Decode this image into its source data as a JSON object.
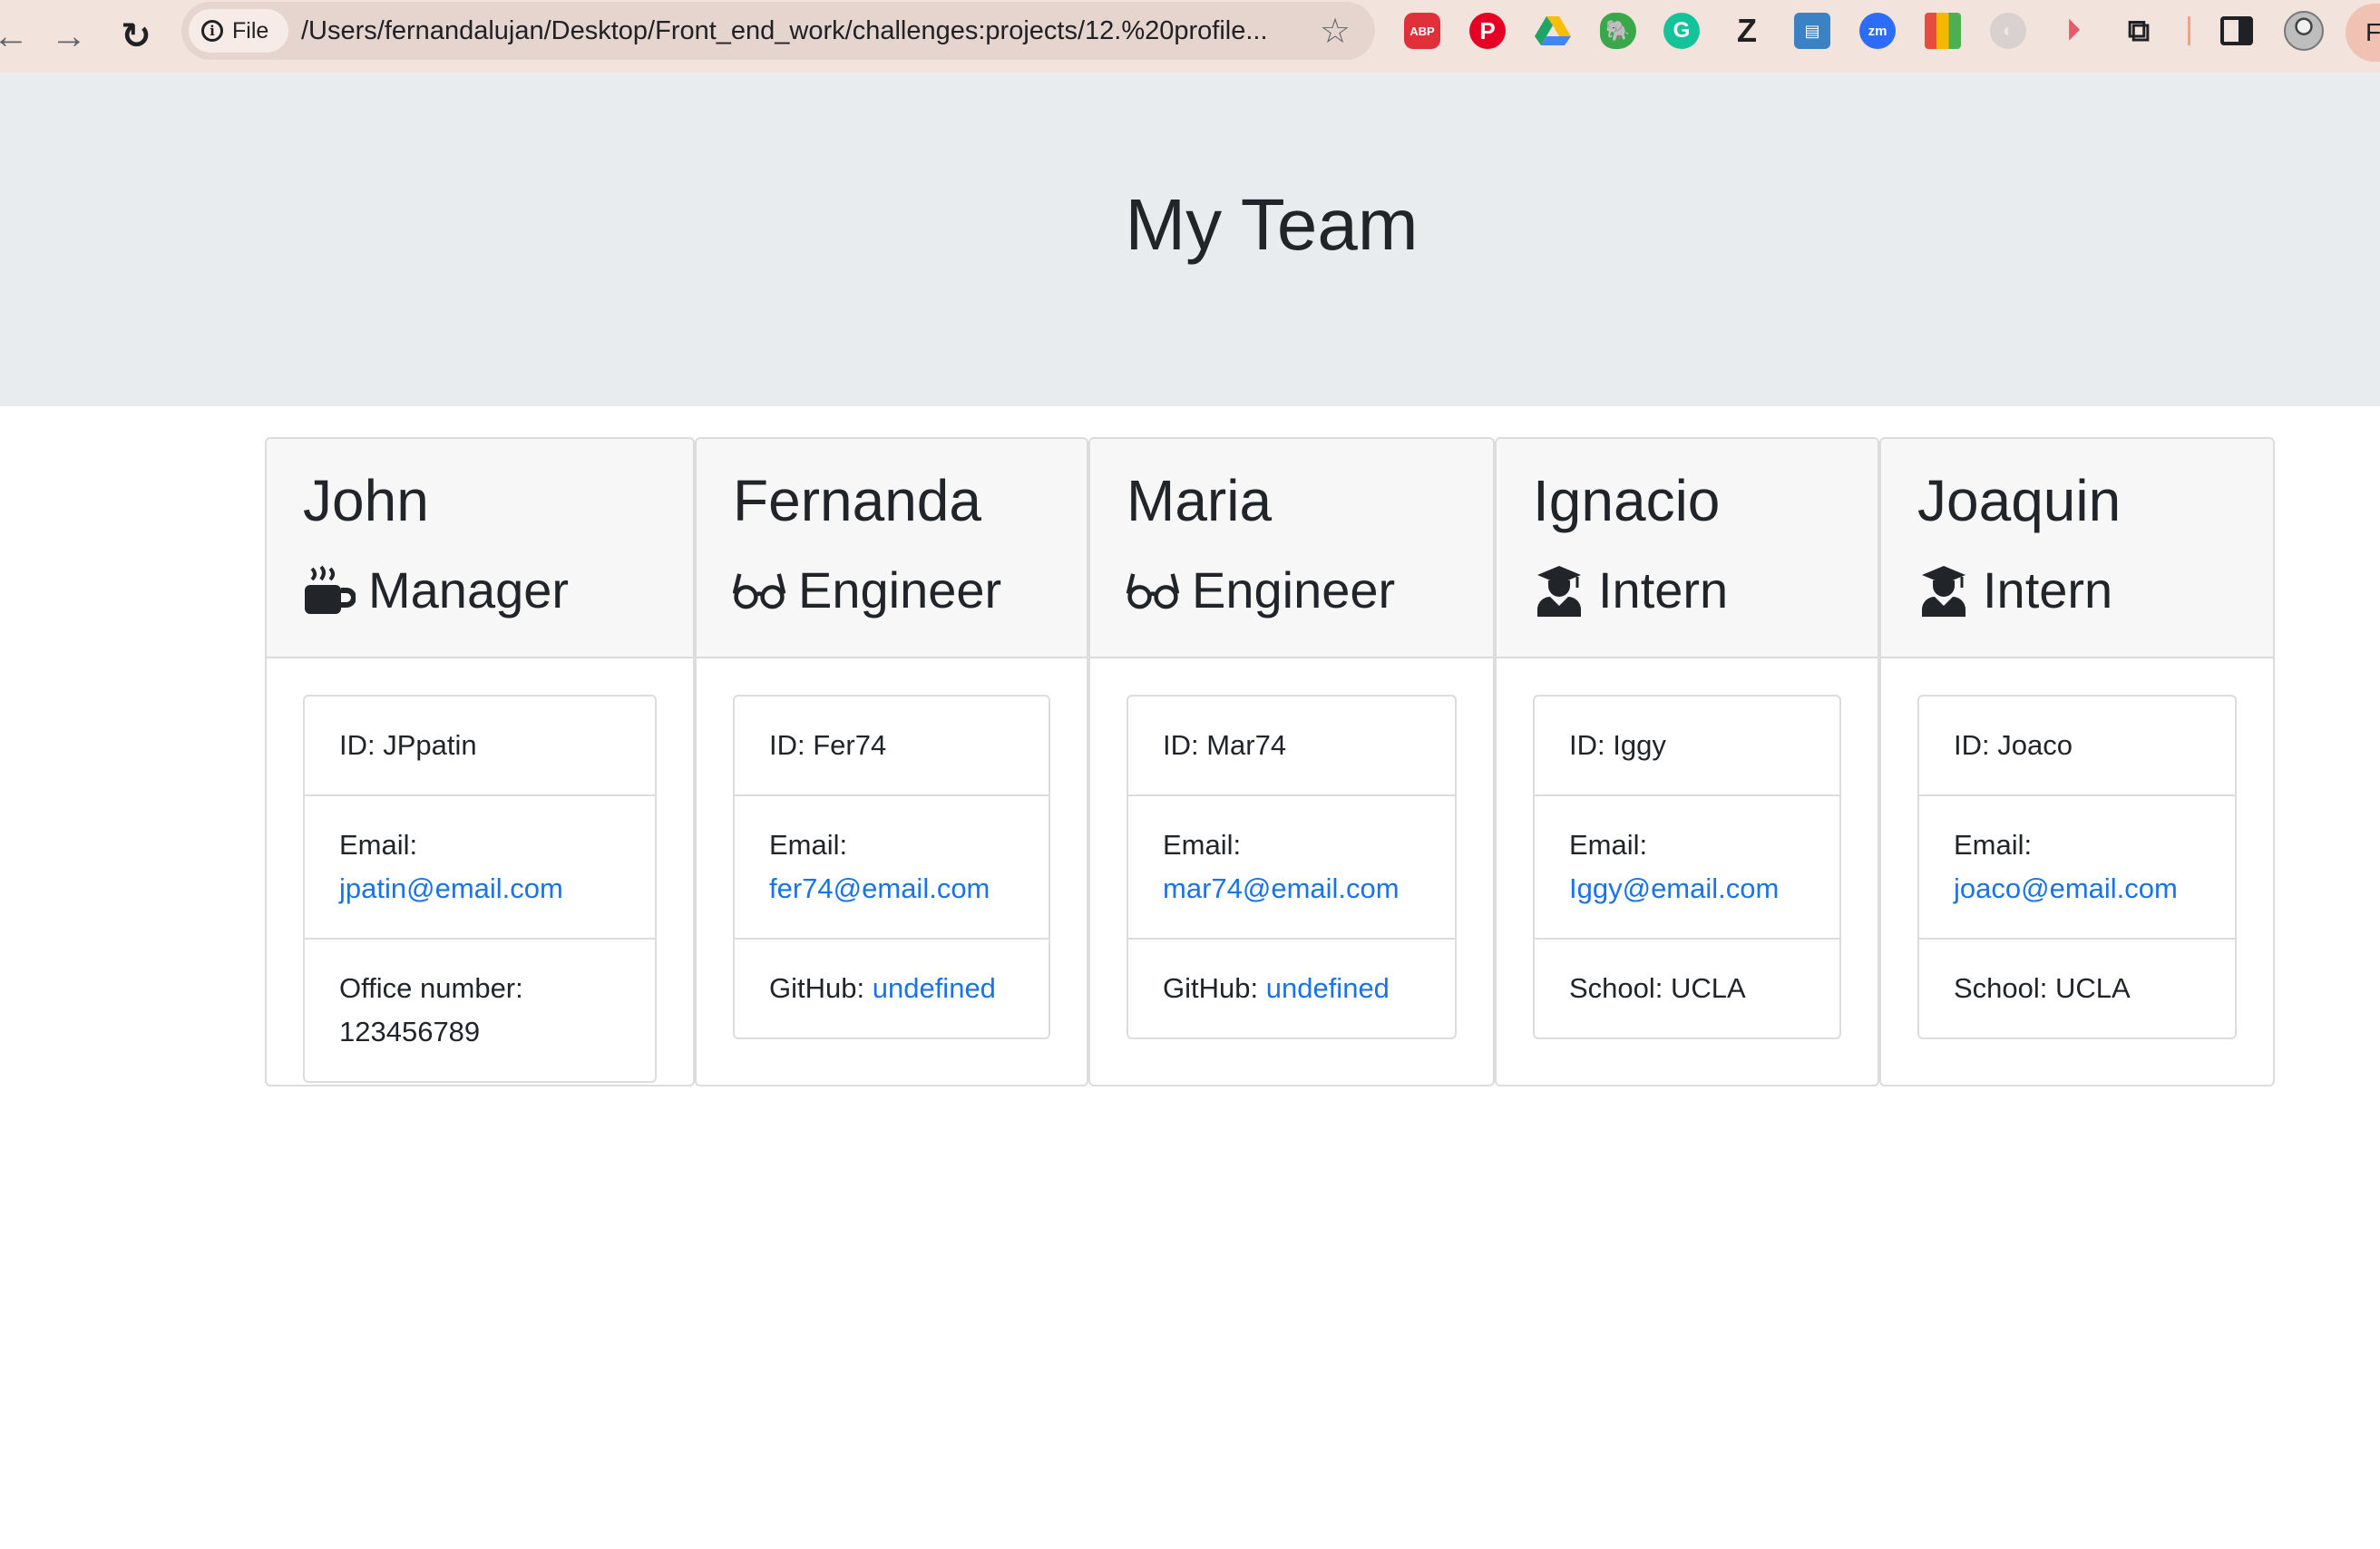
{
  "browser": {
    "nav": {
      "back": "←",
      "forward": "→",
      "reload": "↻"
    },
    "site_chip_label": "File",
    "url": "/Users/fernandalujan/Desktop/Front_end_work/challenges:projects/12.%20profile...",
    "extensions": [
      "abp-icon",
      "pinterest-icon",
      "google-drive-icon",
      "evernote-icon",
      "grammarly-icon",
      "zotero-icon",
      "reader-icon",
      "zoom-icon",
      "color-grid-icon",
      "ghost-icon",
      "screen-recorder-icon",
      "puzzle-extensions-icon"
    ],
    "abp_text": "ABP",
    "zoom_text": "zm",
    "z_text": "Z",
    "profile_initial": "F"
  },
  "page": {
    "title": "My Team"
  },
  "team": [
    {
      "name": "John",
      "role": "Manager",
      "role_icon": "coffee-mug-icon",
      "id_label": "ID: JPpatin",
      "email_label": "Email:",
      "email": "jpatin@email.com",
      "extra_label": "Office number:",
      "extra_value": "123456789"
    },
    {
      "name": "Fernanda",
      "role": "Engineer",
      "role_icon": "glasses-icon",
      "id_label": "ID: Fer74",
      "email_label": "Email:",
      "email": "fer74@email.com",
      "extra_label": "GitHub:",
      "extra_value": "undefined"
    },
    {
      "name": "Maria",
      "role": "Engineer",
      "role_icon": "glasses-icon",
      "id_label": "ID: Mar74",
      "email_label": "Email:",
      "email": "mar74@email.com",
      "extra_label": "GitHub:",
      "extra_value": "undefined"
    },
    {
      "name": "Ignacio",
      "role": "Intern",
      "role_icon": "graduate-icon",
      "id_label": "ID: Iggy",
      "email_label": "Email:",
      "email": "Iggy@email.com",
      "extra_label": "School: UCLA",
      "extra_value": ""
    },
    {
      "name": "Joaquin",
      "role": "Intern",
      "role_icon": "graduate-icon",
      "id_label": "ID: Joaco",
      "email_label": "Email:",
      "email": "joaco@email.com",
      "extra_label": "School: UCLA",
      "extra_value": ""
    }
  ],
  "colors": {
    "link": "#1a73e8",
    "jumbotron": "#e9ecef",
    "toolbar": "#f3e3dd"
  }
}
